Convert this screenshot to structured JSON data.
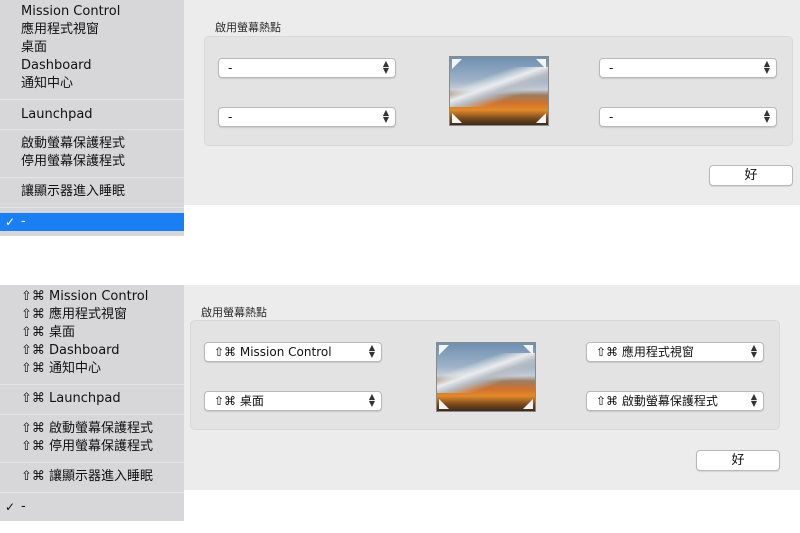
{
  "top": {
    "panel_title": "啟用螢幕熱點",
    "corners": {
      "top_left": "-",
      "top_right": "-",
      "bottom_left": "-",
      "bottom_right": "-"
    },
    "ok_label": "好",
    "menu": {
      "items": [
        "Mission Control",
        "應用程式視窗",
        "桌面",
        "Dashboard",
        "通知中心",
        "Launchpad",
        "啟動螢幕保護程式",
        "停用螢幕保護程式",
        "讓顯示器進入睡眠",
        "-"
      ],
      "checkmark": "✓"
    }
  },
  "bottom": {
    "panel_title": "啟用螢幕熱點",
    "corners": {
      "top_left": "⇧⌘ Mission Control",
      "top_right": "⇧⌘ 應用程式視窗",
      "bottom_left": "⇧⌘ 桌面",
      "bottom_right": "⇧⌘ 啟動螢幕保護程式"
    },
    "ok_label": "好",
    "menu": {
      "items": [
        "⇧⌘ Mission Control",
        "⇧⌘ 應用程式視窗",
        "⇧⌘ 桌面",
        "⇧⌘ Dashboard",
        "⇧⌘ 通知中心",
        "⇧⌘ Launchpad",
        "⇧⌘ 啟動螢幕保護程式",
        "⇧⌘ 停用螢幕保護程式",
        "⇧⌘ 讓顯示器進入睡眠",
        "-"
      ],
      "checkmark": "✓"
    }
  },
  "icons": {
    "popup_arrows": "chevron-up-down-icon",
    "check": "checkmark-icon"
  },
  "colors": {
    "selection": "#1a7ef5",
    "panel_bg": "#ececec",
    "menu_bg": "#d7d6d9"
  }
}
